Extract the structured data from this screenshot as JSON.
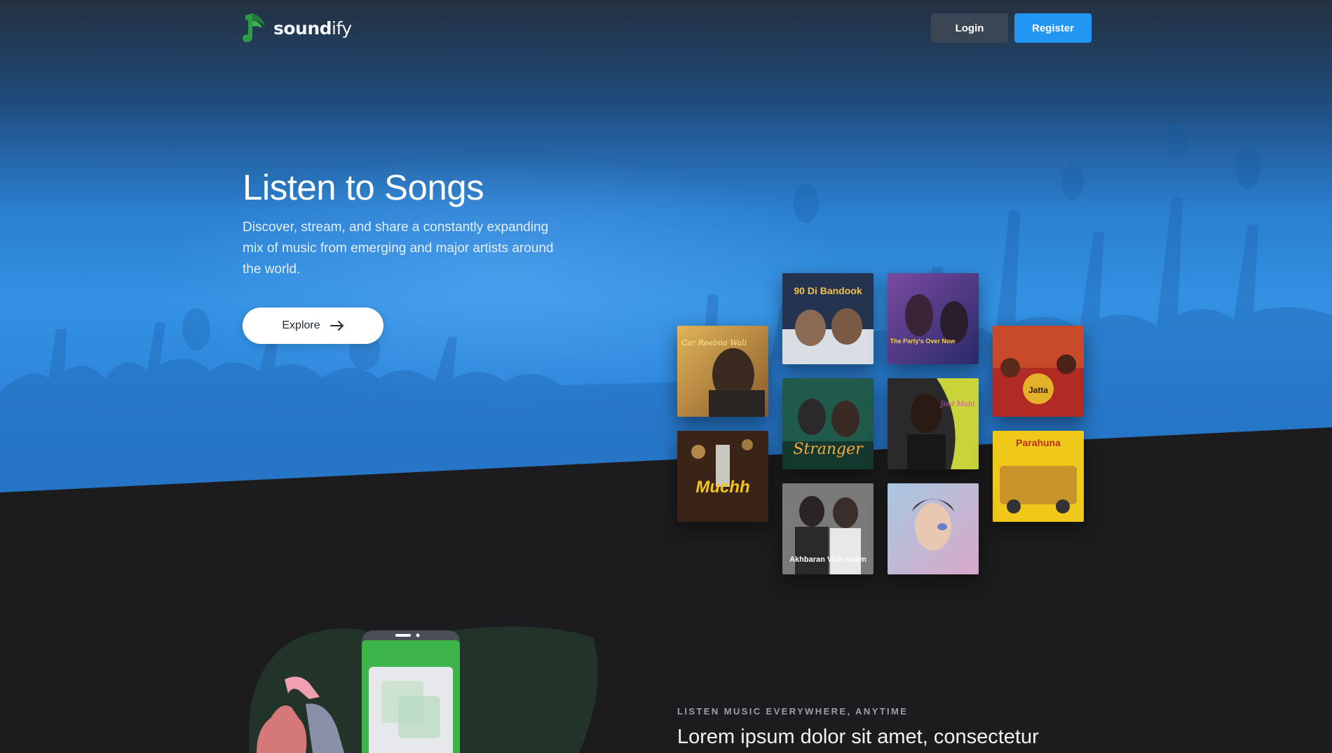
{
  "brand": {
    "name_bold": "sound",
    "name_light": "ify"
  },
  "header": {
    "login_label": "Login",
    "register_label": "Register"
  },
  "hero": {
    "title": "Listen to Songs",
    "description": "Discover, stream, and share a constantly expanding mix of music from emerging and major artists around the world.",
    "explore_label": "Explore"
  },
  "albums": [
    {
      "title": "Car Reebna Wali"
    },
    {
      "title": "90 Di Bandook"
    },
    {
      "title": "The Party's Over Now"
    },
    {
      "title": "Jatta"
    },
    {
      "title": "Stranger"
    },
    {
      "title": "Jind Mahi"
    },
    {
      "title": "Muchh"
    },
    {
      "title": "Parahuna"
    },
    {
      "title": "Akhbaran Vich Naam"
    },
    {
      "title": ""
    }
  ],
  "section": {
    "eyebrow": "LISTEN MUSIC EVERYWHERE, ANYTIME",
    "title": "Lorem ipsum dolor sit amet, consectetur"
  },
  "colors": {
    "accent": "#2196f3",
    "login_bg": "#3b4654",
    "page_bg": "#1c1c1e",
    "hero_blue": "#3391e3",
    "phone_green": "#3cb44a"
  },
  "icons": {
    "logo": "music-note-logo-icon",
    "explore_arrow": "arrow-right-icon"
  }
}
